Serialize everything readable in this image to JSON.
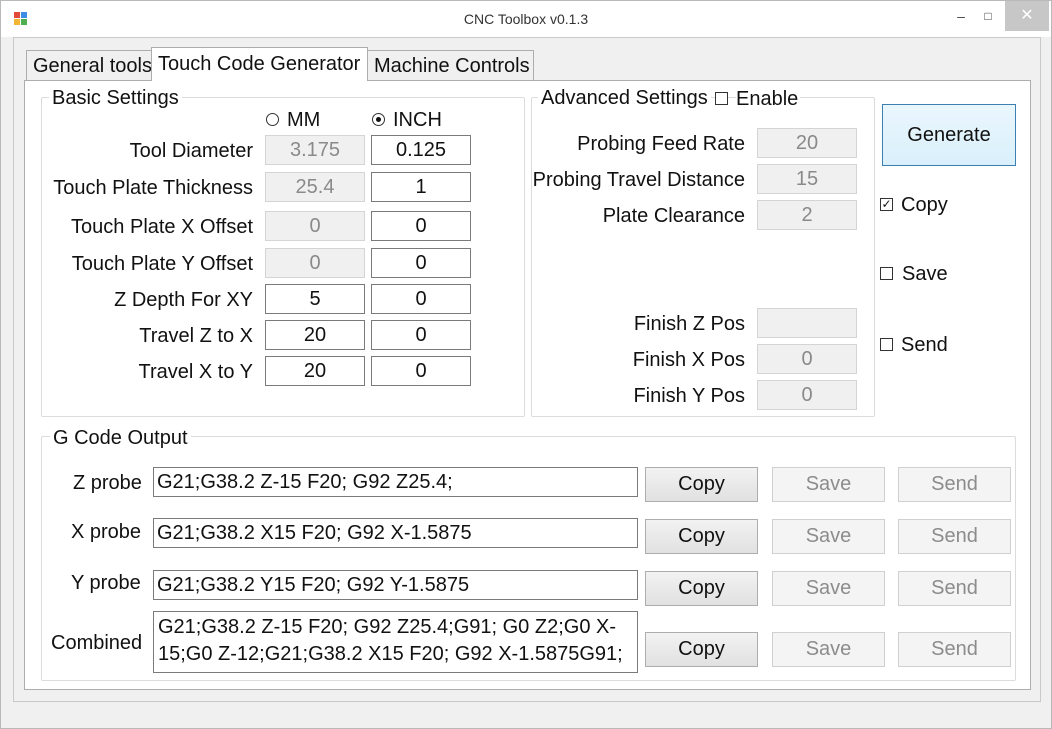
{
  "window": {
    "title": "CNC Toolbox v0.1.3",
    "minimize": "‒",
    "maximize": "□",
    "close": "✕"
  },
  "tabs": [
    {
      "label": "General tools"
    },
    {
      "label": "Touch Code Generator",
      "active": true
    },
    {
      "label": "Machine  Controls"
    }
  ],
  "basic": {
    "legend": "Basic Settings",
    "units": {
      "mm_label": "MM",
      "inch_label": "INCH",
      "selected": "INCH"
    },
    "rows": [
      {
        "label": "Tool Diameter",
        "mm": "3.175",
        "inch": "0.125"
      },
      {
        "label": "Touch Plate Thickness",
        "mm": "25.4",
        "inch": "1"
      },
      {
        "label": "Touch Plate X Offset",
        "mm": "0",
        "inch": "0"
      },
      {
        "label": "Touch Plate Y Offset",
        "mm": "0",
        "inch": "0"
      },
      {
        "label": "Z Depth For XY",
        "mm": "5",
        "inch": "0"
      },
      {
        "label": "Travel Z to X",
        "mm": "20",
        "inch": "0"
      },
      {
        "label": "Travel X to Y",
        "mm": "20",
        "inch": "0"
      }
    ]
  },
  "advanced": {
    "legend": "Advanced Settings",
    "enable_label": "Enable",
    "enabled": false,
    "probing_feed_rate_label": "Probing Feed Rate",
    "probing_feed_rate": "20",
    "probing_travel_distance_label": "Probing Travel Distance",
    "probing_travel_distance": "15",
    "plate_clearance_label": "Plate Clearance",
    "plate_clearance": "2",
    "finish_z_label": "Finish Z Pos",
    "finish_z": "",
    "finish_x_label": "Finish X Pos",
    "finish_x": "0",
    "finish_y_label": "Finish Y Pos",
    "finish_y": "0"
  },
  "actions": {
    "generate_label": "Generate",
    "copy_label": "Copy",
    "copy_checked": true,
    "save_label": "Save",
    "save_checked": false,
    "send_label": "Send",
    "send_checked": false
  },
  "output": {
    "legend": "G Code Output",
    "z_label": "Z probe",
    "z_value": "G21;G38.2 Z-15 F20; G92 Z25.4;",
    "x_label": "X probe",
    "x_value": "G21;G38.2 X15 F20; G92 X-1.5875",
    "y_label": "Y probe",
    "y_value": "G21;G38.2 Y15 F20; G92 Y-1.5875",
    "combined_label": "Combined",
    "combined_value": "G21;G38.2 Z-15 F20; G92 Z25.4;G91; G0 Z2;G0 X-15;G0 Z-12;G21;G38.2 X15 F20; G92 X-1.5875G91;",
    "copy_btn": "Copy",
    "save_btn": "Save",
    "send_btn": "Send"
  },
  "colors": {
    "accent_border": "#3c7fb1",
    "disabled_text": "#8a8a8a",
    "close_button": "#c7c7c7"
  }
}
